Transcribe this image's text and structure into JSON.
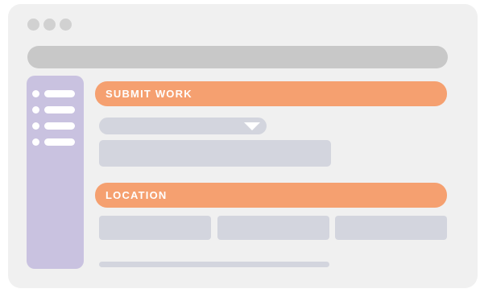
{
  "colors": {
    "window_bg": "#f0f0f0",
    "window_controls": "#d1d1d1",
    "address_bar": "#c8c8c8",
    "sidebar": "#c9c2e0",
    "section_bar": "#f5a070",
    "field": "#d3d5de"
  },
  "window": {
    "controls": [
      "window-dot-icon",
      "window-dot-icon",
      "window-dot-icon"
    ]
  },
  "sidebar": {
    "items": [
      {
        "icon": "bullet-icon"
      },
      {
        "icon": "bullet-icon"
      },
      {
        "icon": "bullet-icon"
      },
      {
        "icon": "bullet-icon"
      }
    ]
  },
  "submit_section": {
    "title": "SUBMIT WORK",
    "dropdown_icon": "chevron-down-icon"
  },
  "location_section": {
    "title": "LOCATION",
    "field_count": 3
  }
}
